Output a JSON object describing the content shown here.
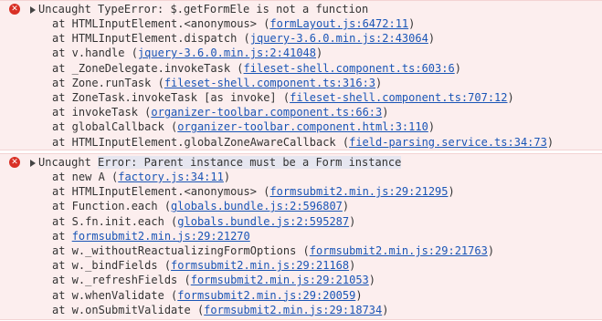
{
  "errors": [
    {
      "message_prefix": "Uncaught TypeError: ",
      "message_highlight": "",
      "message": "$.getFormEle is not a function",
      "frames": [
        {
          "func": "at HTMLInputElement.<anonymous> (",
          "link": "formLayout.js:6472:11",
          "suffix": ")"
        },
        {
          "func": "at HTMLInputElement.dispatch (",
          "link": "jquery-3.6.0.min.js:2:43064",
          "suffix": ")"
        },
        {
          "func": "at v.handle (",
          "link": "jquery-3.6.0.min.js:2:41048",
          "suffix": ")"
        },
        {
          "func": "at _ZoneDelegate.invokeTask (",
          "link": "fileset-shell.component.ts:603:6",
          "suffix": ")"
        },
        {
          "func": "at Zone.runTask (",
          "link": "fileset-shell.component.ts:316:3",
          "suffix": ")"
        },
        {
          "func": "at ZoneTask.invokeTask [as invoke] (",
          "link": "fileset-shell.component.ts:707:12",
          "suffix": ")"
        },
        {
          "func": "at invokeTask (",
          "link": "organizer-toolbar.component.ts:66:3",
          "suffix": ")"
        },
        {
          "func": "at globalCallback (",
          "link": "organizer-toolbar.component.html:3:110",
          "suffix": ")"
        },
        {
          "func": "at HTMLInputElement.globalZoneAwareCallback (",
          "link": "field-parsing.service.ts:34:73",
          "suffix": ")"
        }
      ]
    },
    {
      "message_prefix": "Uncaught ",
      "message_highlight": "Error: Parent instance must be a Form instance",
      "message": "",
      "frames": [
        {
          "func": "at new A (",
          "link": "factory.js:34:11",
          "suffix": ")"
        },
        {
          "func": "at HTMLInputElement.<anonymous> (",
          "link": "formsubmit2.min.js:29:21295",
          "suffix": ")"
        },
        {
          "func": "at Function.each (",
          "link": "globals.bundle.js:2:596807",
          "suffix": ")"
        },
        {
          "func": "at S.fn.init.each (",
          "link": "globals.bundle.js:2:595287",
          "suffix": ")"
        },
        {
          "func": "at ",
          "link": "formsubmit2.min.js:29:21270",
          "suffix": ""
        },
        {
          "func": "at w._withoutReactualizingFormOptions (",
          "link": "formsubmit2.min.js:29:21763",
          "suffix": ")"
        },
        {
          "func": "at w._bindFields (",
          "link": "formsubmit2.min.js:29:21168",
          "suffix": ")"
        },
        {
          "func": "at w._refreshFields (",
          "link": "formsubmit2.min.js:29:21053",
          "suffix": ")"
        },
        {
          "func": "at w.whenValidate (",
          "link": "formsubmit2.min.js:29:20059",
          "suffix": ")"
        },
        {
          "func": "at w.onSubmitValidate (",
          "link": "formsubmit2.min.js:29:18734",
          "suffix": ")"
        }
      ]
    }
  ],
  "icons": {
    "error": "error-circle-x-icon",
    "expand": "expand-triangle-icon",
    "error_glyph": "✕"
  },
  "colors": {
    "error_bg": "#fceeee",
    "error_icon": "#d93025",
    "link": "#1a55b6",
    "text": "#333333"
  }
}
